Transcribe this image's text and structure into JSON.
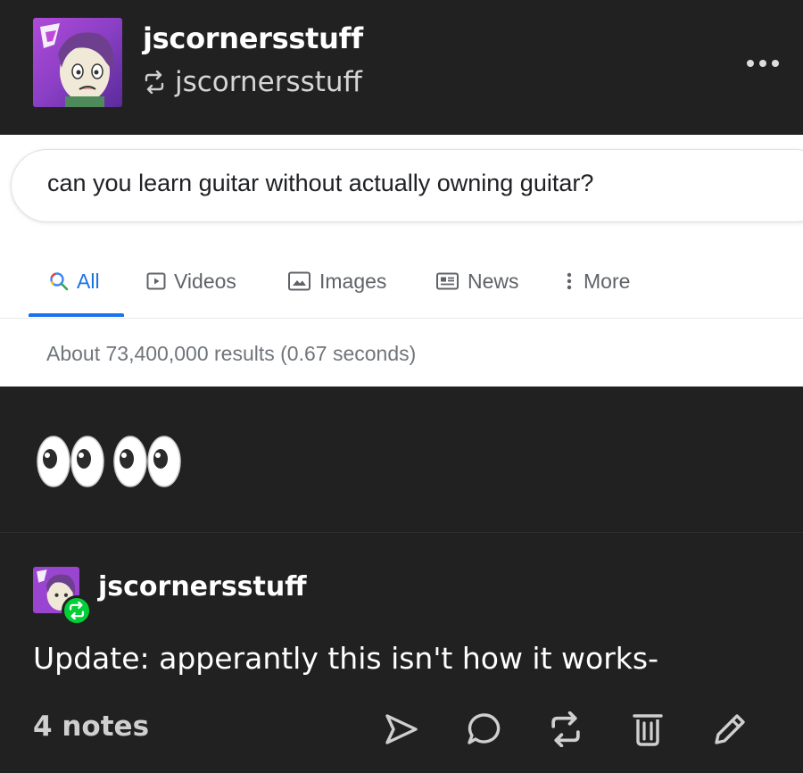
{
  "post": {
    "blog_name": "jscornersstuff",
    "reblogged_from": "jscornersstuff",
    "more_icon": "ellipsis-icon"
  },
  "search_screenshot": {
    "query": "can you learn guitar without actually owning guitar?",
    "tabs": [
      {
        "label": "All",
        "icon": "search-icon",
        "active": true
      },
      {
        "label": "Videos",
        "icon": "video-icon",
        "active": false
      },
      {
        "label": "Images",
        "icon": "image-icon",
        "active": false
      },
      {
        "label": "News",
        "icon": "news-icon",
        "active": false
      },
      {
        "label": "More",
        "icon": "more-vertical-icon",
        "active": false
      }
    ],
    "result_stats": "About 73,400,000 results (0.67 seconds)"
  },
  "body_emoji": "eyes-emoji eyes-emoji",
  "reblog": {
    "author": "jscornersstuff",
    "text": "Update: apperantly this isn't how it works-"
  },
  "footer": {
    "notes": "4 notes",
    "actions": [
      "share-icon",
      "reply-icon",
      "reblog-icon",
      "delete-icon",
      "edit-icon"
    ]
  },
  "colors": {
    "background": "#212121",
    "accent_blue": "#1a73e8",
    "reblog_green": "#00cf35"
  }
}
